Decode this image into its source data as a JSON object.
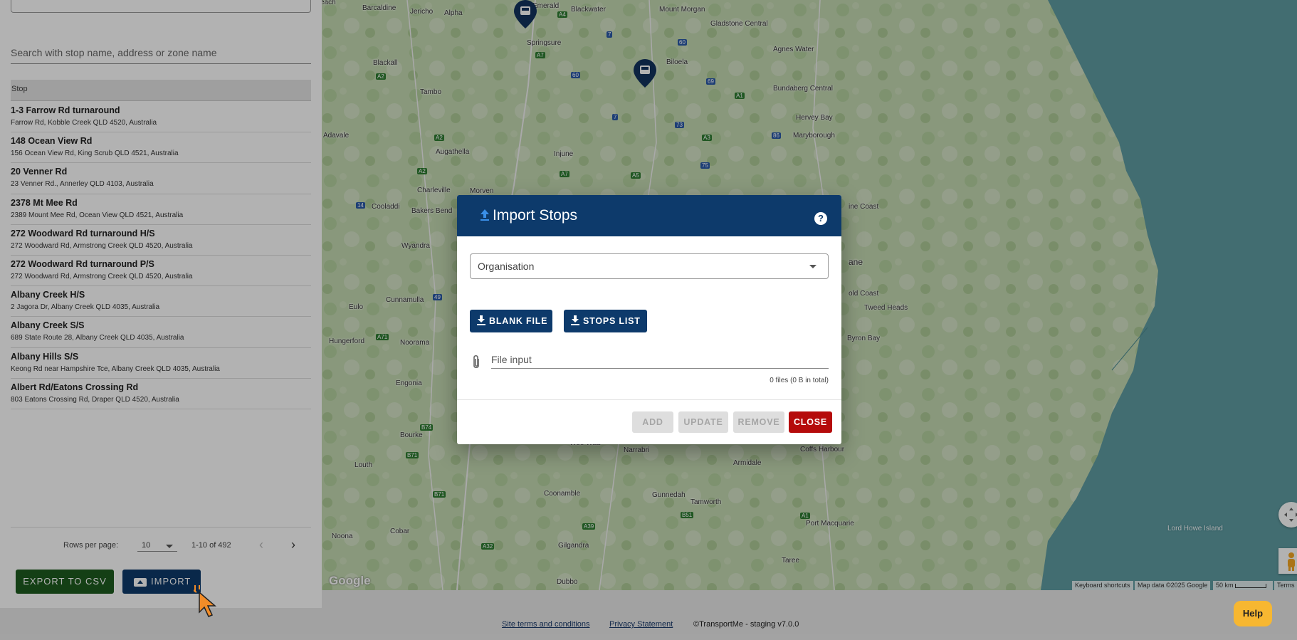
{
  "left_panel": {
    "search_placeholder": "Search with stop name, address or zone name",
    "table_header": "Stop",
    "stops": [
      {
        "name": "1-3 Farrow Rd turnaround",
        "address": "Farrow Rd, Kobble Creek QLD 4520, Australia"
      },
      {
        "name": "148 Ocean View Rd",
        "address": "156 Ocean View Rd, King Scrub QLD 4521, Australia"
      },
      {
        "name": "20 Venner Rd",
        "address": "23 Venner Rd., Annerley QLD 4103, Australia"
      },
      {
        "name": "2378 Mt Mee Rd",
        "address": "2389 Mount Mee Rd, Ocean View QLD 4521, Australia"
      },
      {
        "name": "272 Woodward Rd turnaround H/S",
        "address": "272 Woodward Rd, Armstrong Creek QLD 4520, Australia"
      },
      {
        "name": "272 Woodward Rd turnaround P/S",
        "address": "272 Woodward Rd, Armstrong Creek QLD 4520, Australia"
      },
      {
        "name": "Albany Creek H/S",
        "address": "2 Jagora Dr, Albany Creek QLD 4035, Australia"
      },
      {
        "name": "Albany Creek S/S",
        "address": "689 State Route 28, Albany Creek QLD 4035, Australia"
      },
      {
        "name": "Albany Hills S/S",
        "address": "Keong Rd near Hampshire Tce, Albany Creek QLD 4035, Australia"
      },
      {
        "name": "Albert Rd/Eatons Crossing Rd",
        "address": "803 Eatons Crossing Rd, Draper QLD 4520, Australia"
      }
    ],
    "pagination": {
      "rows_per_page_label": "Rows per page:",
      "rows_per_page_value": "10",
      "range": "1-10 of 492",
      "prev_icon": "chevron-left-icon",
      "next_icon": "chevron-right-icon"
    },
    "export_label": "EXPORT TO CSV",
    "import_label": "IMPORT"
  },
  "map": {
    "places": [
      "Barcaldine",
      "Jericho",
      "Alpha",
      "Emerald",
      "Blackwater",
      "Mount Morgan",
      "Gladstone Central",
      "Agnes Water",
      "Springsure",
      "Biloela",
      "Bundaberg Central",
      "Blackall",
      "Tambo",
      "Hervey Bay",
      "Maryborough",
      "Adavale",
      "Augathella",
      "Injune",
      "Charleville",
      "Morven",
      "Cooladdi",
      "Bakers Bend",
      "Wyandra",
      "Cunnamulla",
      "Eulo",
      "Hungerford",
      "Noorama",
      "Engonia",
      "Bourke",
      "Louth",
      "Wee Waa",
      "Narrabri",
      "Armidale",
      "Coonamble",
      "Gunnedah",
      "Tamworth",
      "Coffs Harbour",
      "Gilgandra",
      "Cobar",
      "Dubbo",
      "Noona",
      "Port Macquarie",
      "Taree",
      "Lord Howe Island",
      "Sunshine Coast",
      "Brisbane",
      "Gold Coast",
      "Tweed Heads",
      "Byron Bay"
    ],
    "place_sunshine": "ine Coast",
    "place_brisbane": "ane",
    "place_goldcoast": "old Coast",
    "logo": "Google",
    "attrib_keyboard": "Keyboard shortcuts",
    "attrib_data": "Map data ©2025 Google",
    "attrib_scale": "50 km",
    "attrib_terms": "Terms"
  },
  "dialog": {
    "title": "Import Stops",
    "help_icon": "help-circle-icon",
    "organisation_label": "Organisation",
    "blank_file_label": "BLANK FILE",
    "stops_list_label": "STOPS LIST",
    "file_input_label": "File input",
    "file_count": "0 files (0 B in total)",
    "add_label": "ADD",
    "update_label": "UPDATE",
    "remove_label": "REMOVE",
    "close_label": "CLOSE"
  },
  "footer": {
    "terms": "Site terms and conditions",
    "privacy": "Privacy Statement",
    "copyright": "©TransportMe - staging v7.0.0"
  },
  "help_label": "Help",
  "colors": {
    "primary": "#0d3a6b",
    "export": "#1e5b1f",
    "close": "#b50b0b",
    "help": "#f7b731"
  }
}
